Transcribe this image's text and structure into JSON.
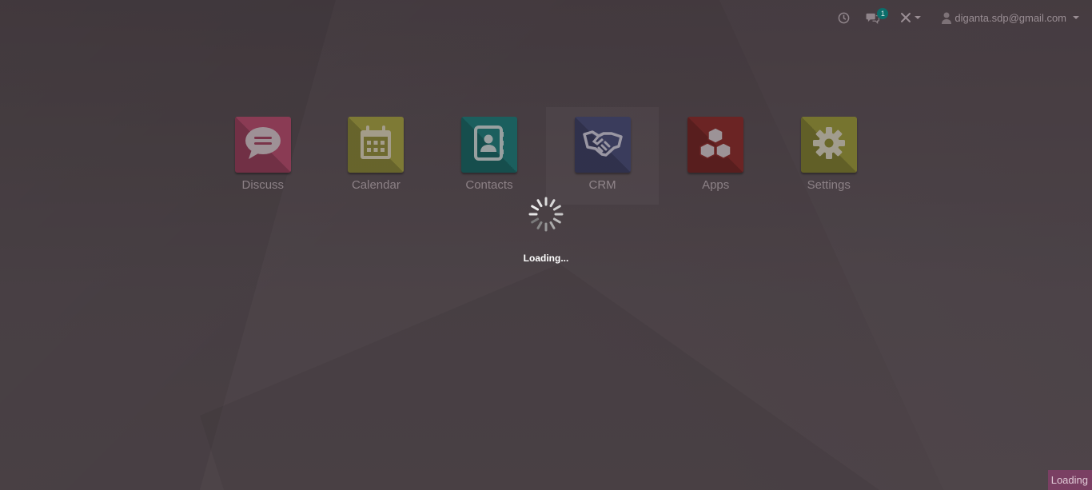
{
  "systray": {
    "activity_icon": "clock-icon",
    "messages_icon": "comments-icon",
    "messages_count": "1",
    "debug_icon": "tools-icon",
    "user_icon": "user-icon",
    "user_email": "diganta.sdp@gmail.com"
  },
  "apps": [
    {
      "label": "Discuss",
      "icon": "chat-bubble-icon",
      "color": "#8a3b54"
    },
    {
      "label": "Calendar",
      "icon": "calendar-icon",
      "color": "#7e7a35"
    },
    {
      "label": "Contacts",
      "icon": "address-book-icon",
      "color": "#1b5f5e"
    },
    {
      "label": "CRM",
      "icon": "handshake-icon",
      "color": "#3a3c5c"
    },
    {
      "label": "Apps",
      "icon": "cubes-icon",
      "color": "#6b2424"
    },
    {
      "label": "Settings",
      "icon": "gear-icon",
      "color": "#76742f"
    }
  ],
  "loader": {
    "text": "Loading...",
    "corner_text": "Loading"
  },
  "colors": {
    "overlay": "#000000",
    "badge": "#0c6d6a",
    "corner_loading": "#7a3f63"
  }
}
